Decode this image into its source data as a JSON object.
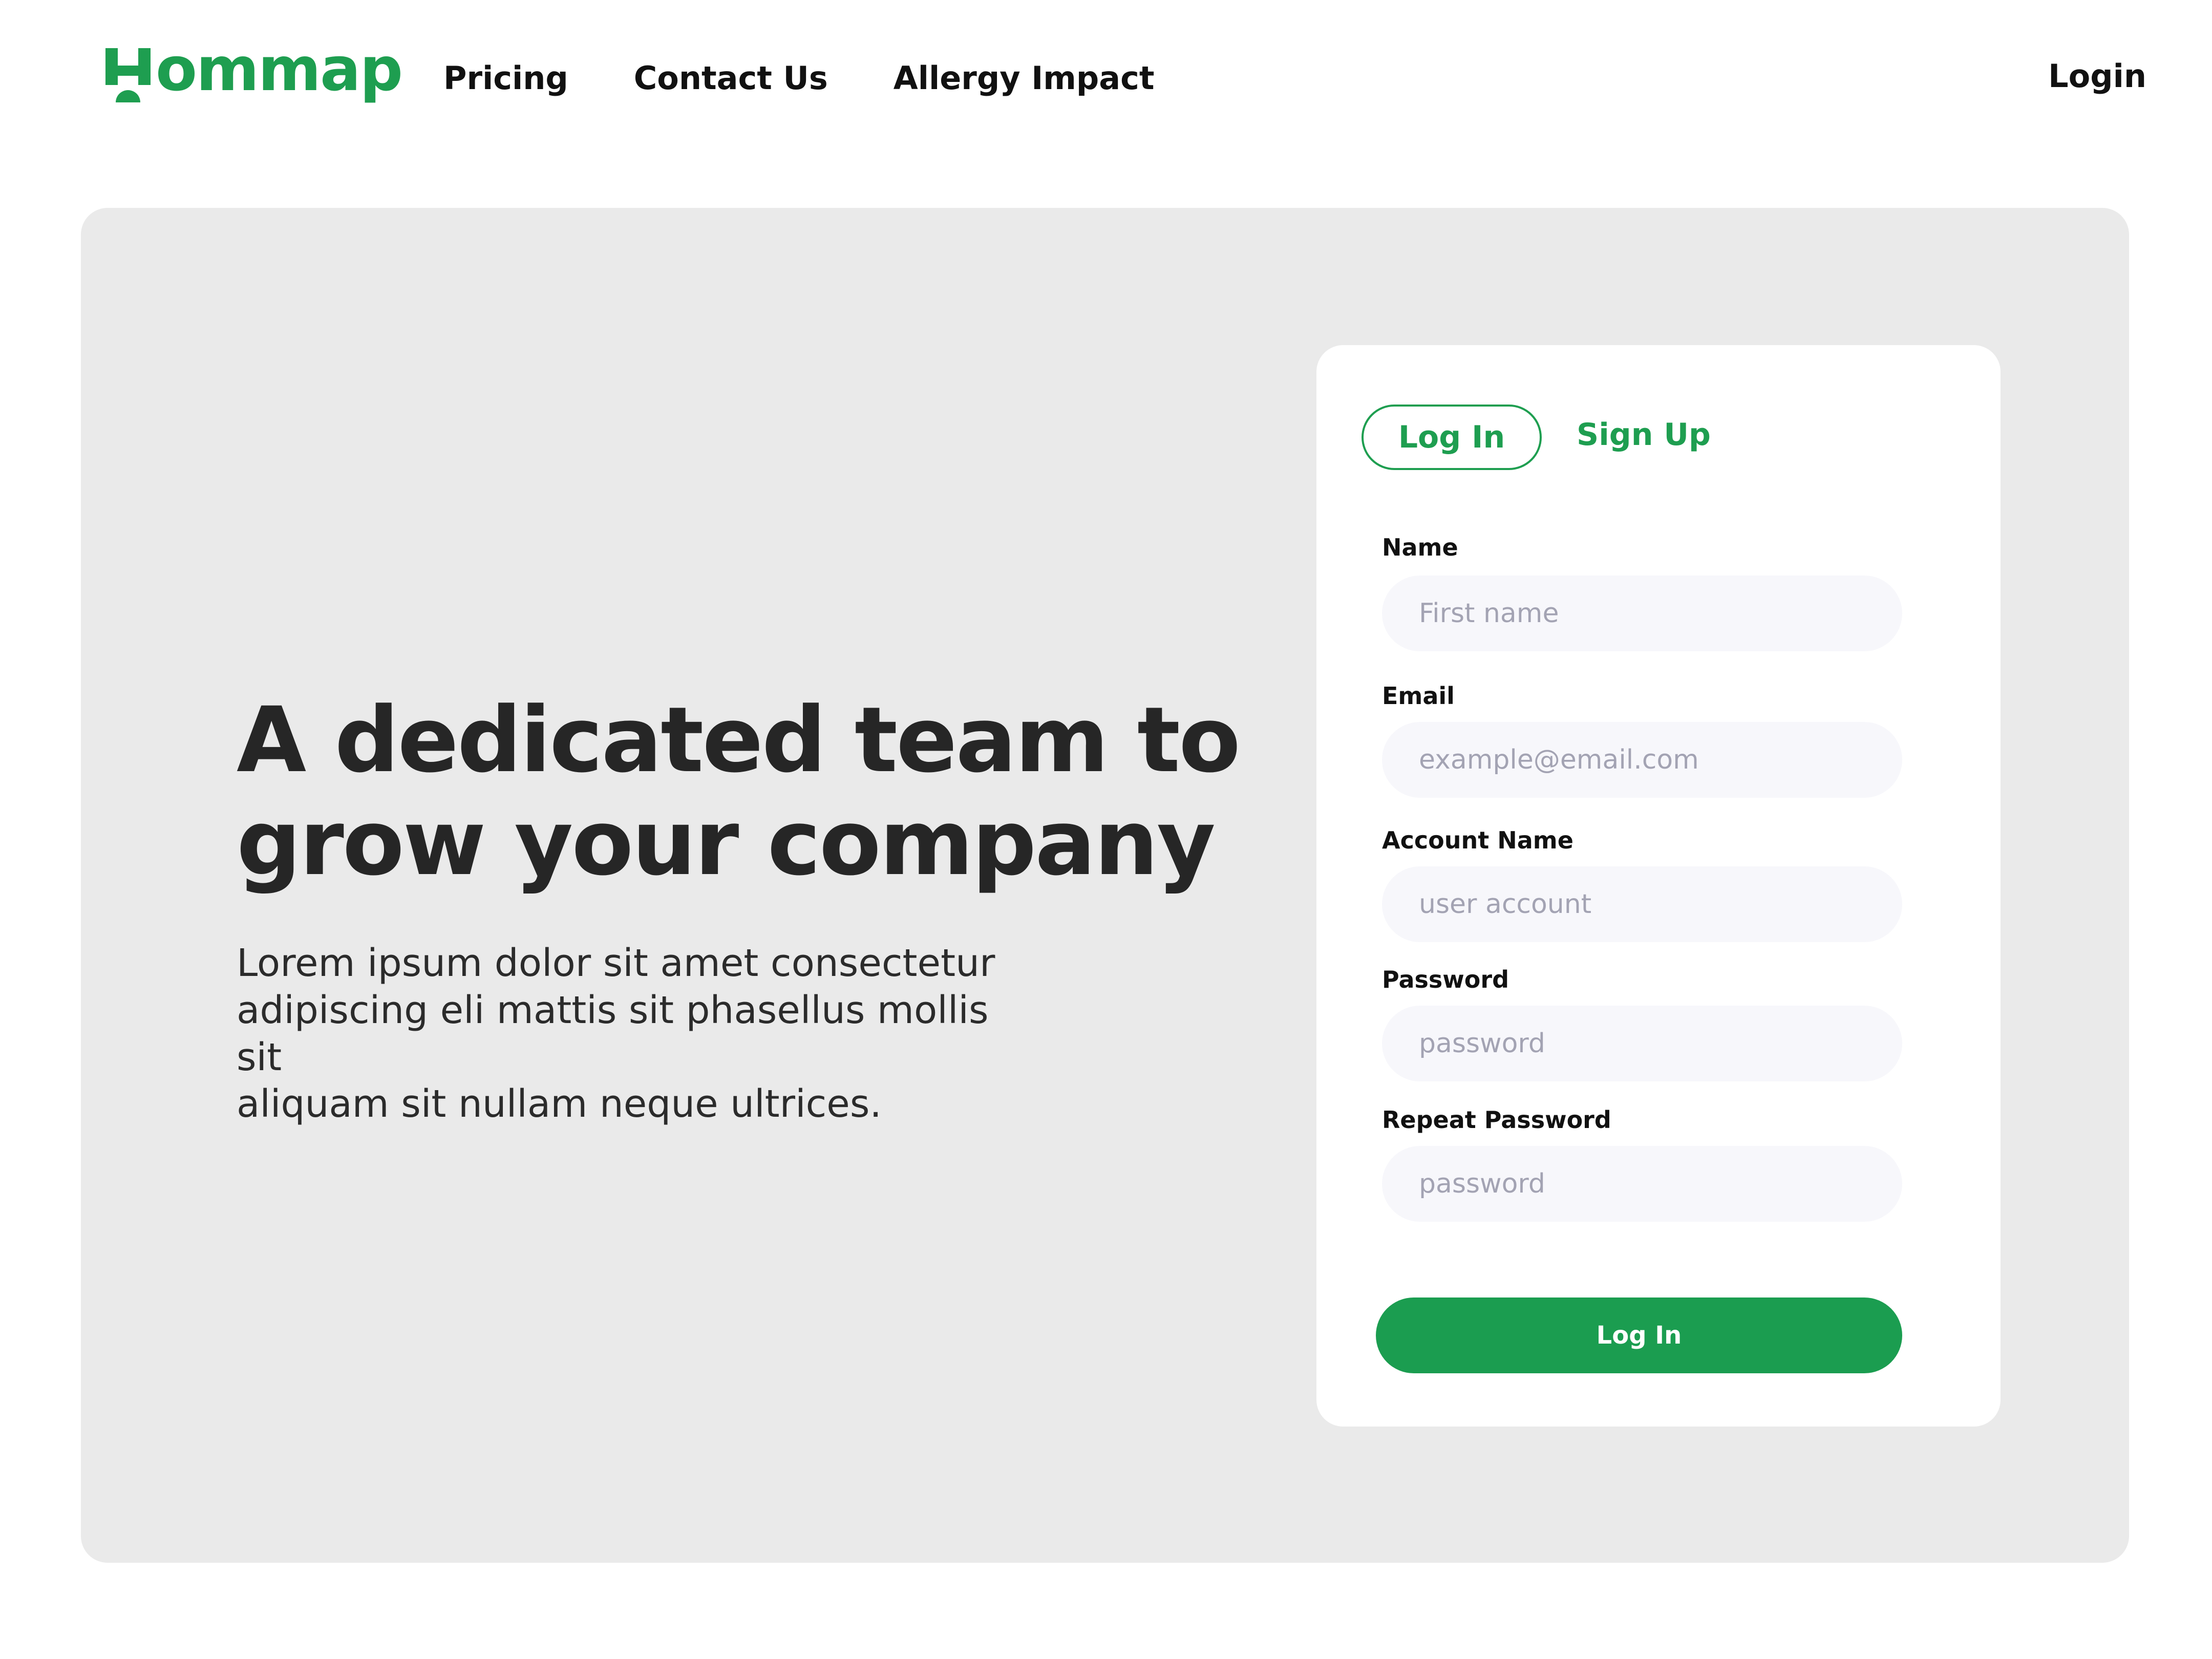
{
  "brand": {
    "name": "Hommap",
    "wordmark": "ommap",
    "color": "#1e9e50"
  },
  "nav": {
    "items": [
      {
        "label": "Pricing"
      },
      {
        "label": "Contact Us"
      },
      {
        "label": "Allergy Impact"
      }
    ],
    "login_label": "Login"
  },
  "hero": {
    "headline_line1": "A dedicated team to",
    "headline_line2": "grow your company",
    "body_line1": "Lorem ipsum dolor sit amet consectetur",
    "body_line2": "adipiscing eli mattis sit phasellus mollis sit",
    "body_line3": "aliquam sit nullam neque ultrices."
  },
  "form": {
    "tabs": {
      "login": "Log In",
      "signup": "Sign Up",
      "active": "login"
    },
    "fields": {
      "name": {
        "label": "Name",
        "placeholder": "First name",
        "value": ""
      },
      "email": {
        "label": "Email",
        "placeholder": "example@email.com",
        "value": ""
      },
      "account": {
        "label": "Account Name",
        "placeholder": "user account",
        "value": ""
      },
      "password": {
        "label": "Password",
        "placeholder": "password",
        "value": ""
      },
      "repeat_password": {
        "label": "Repeat Password",
        "placeholder": "password",
        "value": ""
      }
    },
    "submit_label": "Log In"
  },
  "colors": {
    "accent": "#1e9e50",
    "hero_background": "#eaeaea",
    "input_background": "#f7f7fb"
  }
}
